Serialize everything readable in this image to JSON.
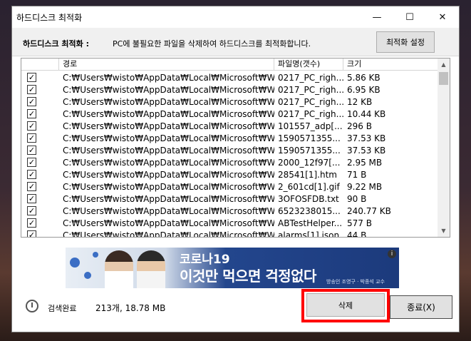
{
  "window": {
    "title": "하드디스크 최적화",
    "controls": {
      "minimize": "—",
      "maximize": "☐",
      "close": "✕"
    }
  },
  "infobar": {
    "label": "하드디스크 최적화 :",
    "description": "PC에 불필요한 파일을 삭제하여 하드디스크를 최적화합니다.",
    "settings_button": "최적화 설정"
  },
  "table": {
    "headers": [
      "",
      "경로",
      "파일명(갯수)",
      "크기"
    ],
    "rows": [
      {
        "checked": true,
        "path": "C:₩Users₩wisto₩AppData₩Local₩Microsoft₩Wi...",
        "name": "0217_PC_righ...",
        "size": "5.86 KB"
      },
      {
        "checked": true,
        "path": "C:₩Users₩wisto₩AppData₩Local₩Microsoft₩Wi...",
        "name": "0217_PC_righ...",
        "size": "6.95 KB"
      },
      {
        "checked": true,
        "path": "C:₩Users₩wisto₩AppData₩Local₩Microsoft₩Wi...",
        "name": "0217_PC_righ...",
        "size": "12 KB"
      },
      {
        "checked": true,
        "path": "C:₩Users₩wisto₩AppData₩Local₩Microsoft₩Wi...",
        "name": "0217_PC_righ...",
        "size": "10.44 KB"
      },
      {
        "checked": true,
        "path": "C:₩Users₩wisto₩AppData₩Local₩Microsoft₩Wi...",
        "name": "101557_adp[...",
        "size": "296 B"
      },
      {
        "checked": true,
        "path": "C:₩Users₩wisto₩AppData₩Local₩Microsoft₩Wi...",
        "name": "1590571355...",
        "size": "37.53 KB"
      },
      {
        "checked": true,
        "path": "C:₩Users₩wisto₩AppData₩Local₩Microsoft₩Wi...",
        "name": "1590571355...",
        "size": "37.53 KB"
      },
      {
        "checked": true,
        "path": "C:₩Users₩wisto₩AppData₩Local₩Microsoft₩Wi...",
        "name": "2000_12f97[...",
        "size": "2.95 MB"
      },
      {
        "checked": true,
        "path": "C:₩Users₩wisto₩AppData₩Local₩Microsoft₩Wi...",
        "name": "28541[1].htm",
        "size": "71 B"
      },
      {
        "checked": true,
        "path": "C:₩Users₩wisto₩AppData₩Local₩Microsoft₩Wi...",
        "name": "2_601cd[1].gif",
        "size": "9.22 MB"
      },
      {
        "checked": true,
        "path": "C:₩Users₩wisto₩AppData₩Local₩Microsoft₩Wi...",
        "name": "3OFOSFDB.txt",
        "size": "90 B"
      },
      {
        "checked": true,
        "path": "C:₩Users₩wisto₩AppData₩Local₩Microsoft₩Wi...",
        "name": "6523238015...",
        "size": "240.77 KB"
      },
      {
        "checked": true,
        "path": "C:₩Users₩wisto₩AppData₩Local₩Microsoft₩Wi...",
        "name": "ABTestHelper...",
        "size": "577 B"
      },
      {
        "checked": true,
        "path": "C:₩Users₩wisto₩AppData₩Local₩Microsoft₩Wi...",
        "name": "alarms[1].json",
        "size": "44 B"
      }
    ]
  },
  "banner": {
    "line1": "코로나19",
    "line2": "이것만 먹으면 걱정없다",
    "credit": "방송인 조영구 · 박종석 교수",
    "info_icon": "i"
  },
  "status": {
    "text": "검색완료",
    "summary": "213개, 18.78 MB"
  },
  "buttons": {
    "delete": "삭제",
    "exit": "종료(X)"
  },
  "colors": {
    "highlight": "#ff0000",
    "banner_blue": "#1c3a7c"
  }
}
